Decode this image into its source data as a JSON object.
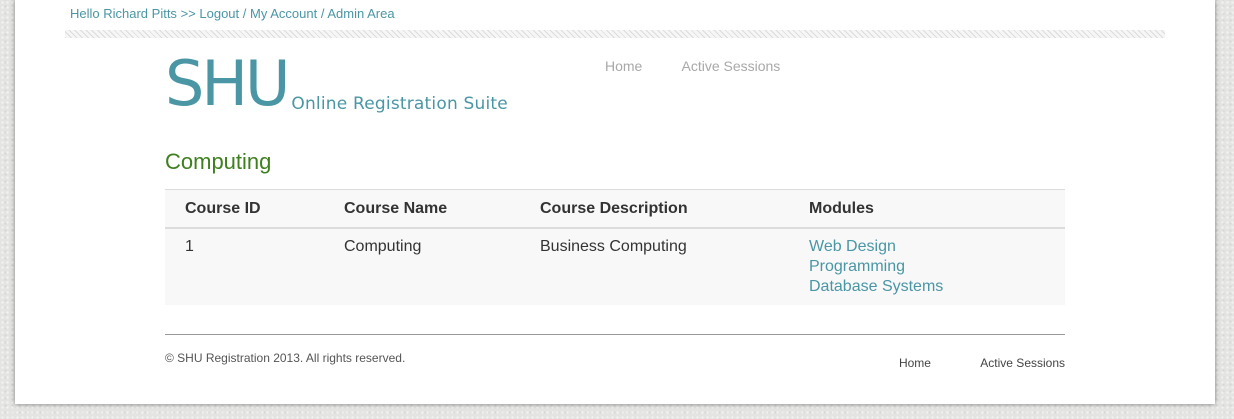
{
  "userbar": {
    "greeting": "Hello Richard Pitts",
    "separator": ">>",
    "logout": "Logout",
    "slash": "/",
    "my_account": "My Account",
    "admin_area": "Admin Area"
  },
  "logo": {
    "title": "SHU",
    "subtitle": "Online Registration Suite"
  },
  "nav": {
    "items": [
      {
        "label": "Home"
      },
      {
        "label": "Active Sessions"
      }
    ]
  },
  "main": {
    "heading": "Computing",
    "table": {
      "headers": [
        "Course ID",
        "Course Name",
        "Course Description",
        "Modules"
      ],
      "rows": [
        {
          "id": "1",
          "name": "Computing",
          "description": "Business Computing",
          "modules": [
            "Web Design",
            "Programming",
            "Database Systems"
          ]
        }
      ]
    }
  },
  "footer": {
    "copyright": "© SHU Registration 2013. All rights reserved.",
    "nav": [
      {
        "label": "Home"
      },
      {
        "label": "Active Sessions"
      }
    ]
  },
  "colors": {
    "accent": "#4a96a5",
    "heading": "#3e7f1e",
    "nav_text": "#a8a8a8"
  }
}
